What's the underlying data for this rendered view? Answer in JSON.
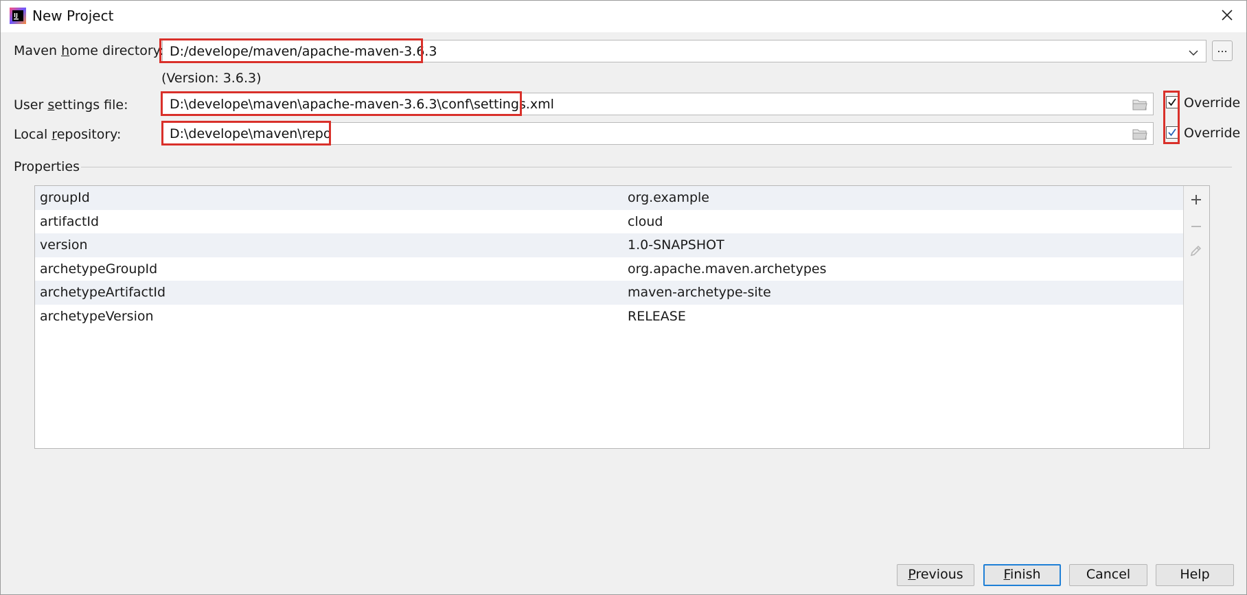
{
  "window": {
    "title": "New Project",
    "app_icon": "intellij-icon",
    "close_icon": "close-icon"
  },
  "maven_home": {
    "label_before": "Maven ",
    "label_mnemonic": "h",
    "label_after": "ome directory:",
    "value": "D:/develope/maven/apache-maven-3.6.3",
    "version_note": "(Version: 3.6.3)",
    "browse_label": "..."
  },
  "user_settings": {
    "label_before": "User ",
    "label_mnemonic": "s",
    "label_after": "ettings file:",
    "value": "D:\\develope\\maven\\apache-maven-3.6.3\\conf\\settings.xml",
    "override_label": "Override",
    "override_checked": true
  },
  "local_repo": {
    "label_before": "Local ",
    "label_mnemonic": "r",
    "label_after": "epository:",
    "value": "D:\\develope\\maven\\repo",
    "override_label": "Override",
    "override_checked": true
  },
  "properties": {
    "title": "Properties",
    "rows": [
      {
        "key": "groupId",
        "value": "org.example"
      },
      {
        "key": "artifactId",
        "value": "cloud"
      },
      {
        "key": "version",
        "value": "1.0-SNAPSHOT"
      },
      {
        "key": "archetypeGroupId",
        "value": "org.apache.maven.archetypes"
      },
      {
        "key": "archetypeArtifactId",
        "value": "maven-archetype-site"
      },
      {
        "key": "archetypeVersion",
        "value": "RELEASE"
      }
    ],
    "tools": [
      "plus-icon",
      "minus-icon",
      "pencil-icon"
    ]
  },
  "buttons": {
    "previous": {
      "mnemonic": "P",
      "rest": "revious"
    },
    "finish": {
      "mnemonic": "F",
      "rest": "inish"
    },
    "cancel": "Cancel",
    "help": "Help"
  },
  "colors": {
    "highlight": "#d9302a",
    "primary_border": "#1e7fd6",
    "checkbox_check": "#2a63b8"
  }
}
